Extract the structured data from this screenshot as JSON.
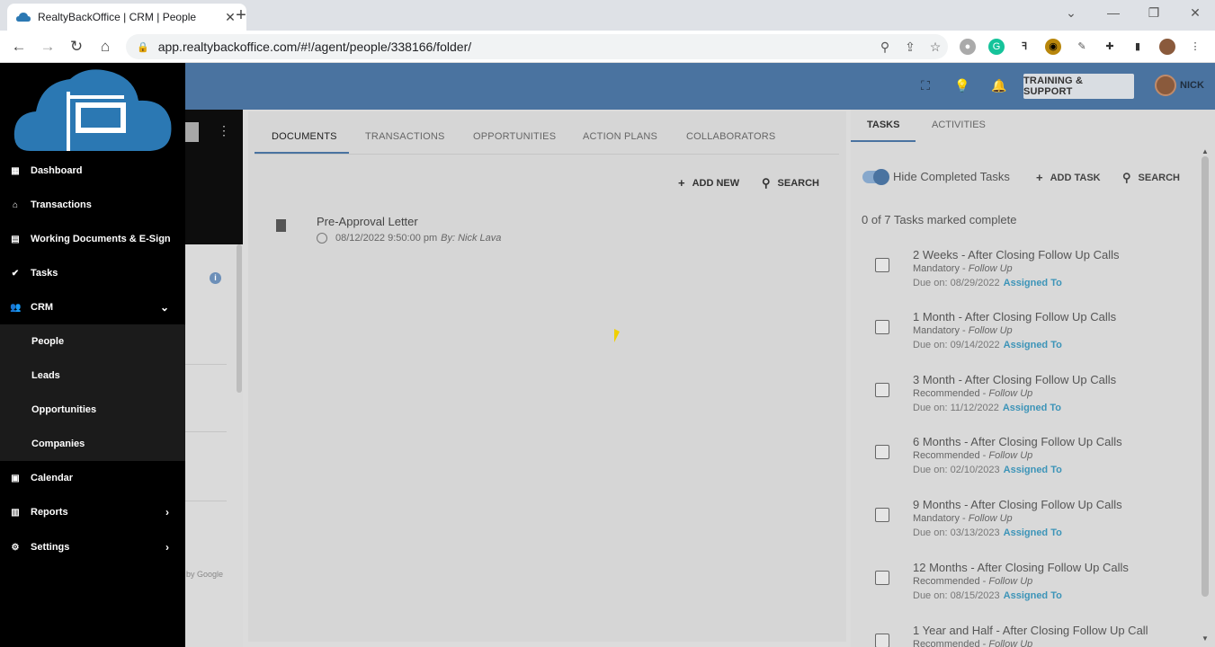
{
  "browser": {
    "tab_title": "RealtyBackOffice | CRM | People",
    "url": "app.realtybackoffice.com/#!/agent/people/338166/folder/"
  },
  "header": {
    "training_label": "TRAINING & SUPPORT",
    "user_name": "NICK"
  },
  "sidebar": {
    "items": [
      {
        "label": "Dashboard"
      },
      {
        "label": "Transactions"
      },
      {
        "label": "Working Documents & E-Sign"
      },
      {
        "label": "Tasks"
      },
      {
        "label": "CRM"
      },
      {
        "label": "Calendar"
      },
      {
        "label": "Reports"
      },
      {
        "label": "Settings"
      }
    ],
    "crm_subitems": [
      {
        "label": "People"
      },
      {
        "label": "Leads"
      },
      {
        "label": "Opportunities"
      },
      {
        "label": "Companies"
      }
    ]
  },
  "middle": {
    "google_credit": "by Google"
  },
  "documents": {
    "tabs": [
      {
        "label": "DOCUMENTS"
      },
      {
        "label": "TRANSACTIONS"
      },
      {
        "label": "OPPORTUNITIES"
      },
      {
        "label": "ACTION PLANS"
      },
      {
        "label": "COLLABORATORS"
      }
    ],
    "add_new_label": "ADD NEW",
    "search_label": "SEARCH",
    "items": [
      {
        "title": "Pre-Approval Letter",
        "date": "08/12/2022 9:50:00 pm",
        "by": "By: Nick Lava"
      }
    ]
  },
  "tasks": {
    "tabs": [
      {
        "label": "TASKS"
      },
      {
        "label": "ACTIVITIES"
      }
    ],
    "hide_completed_label": "Hide Completed Tasks",
    "hide_completed_on": true,
    "add_task_label": "ADD TASK",
    "search_label": "SEARCH",
    "complete_count": "0 of 7 Tasks marked complete",
    "items": [
      {
        "title": "2 Weeks - After Closing Follow Up Calls",
        "priority": "Mandatory",
        "category": "Follow Up",
        "due": "Due on: 08/29/2022",
        "assigned": "Assigned To"
      },
      {
        "title": "1 Month - After Closing Follow Up Calls",
        "priority": "Mandatory",
        "category": "Follow Up",
        "due": "Due on: 09/14/2022",
        "assigned": "Assigned To"
      },
      {
        "title": "3 Month - After Closing Follow Up Calls",
        "priority": "Recommended",
        "category": "Follow Up",
        "due": "Due on: 11/12/2022",
        "assigned": "Assigned To"
      },
      {
        "title": "6 Months - After Closing Follow Up Calls",
        "priority": "Recommended",
        "category": "Follow Up",
        "due": "Due on: 02/10/2023",
        "assigned": "Assigned To"
      },
      {
        "title": "9 Months - After Closing Follow Up Calls",
        "priority": "Mandatory",
        "category": "Follow Up",
        "due": "Due on: 03/13/2023",
        "assigned": "Assigned To"
      },
      {
        "title": "12 Months - After Closing Follow Up Calls",
        "priority": "Recommended",
        "category": "Follow Up",
        "due": "Due on: 08/15/2023",
        "assigned": "Assigned To"
      },
      {
        "title": "1 Year and Half - After Closing Follow Up Call",
        "priority": "Recommended",
        "category": "Follow Up",
        "due": "",
        "assigned": ""
      }
    ]
  },
  "colors": {
    "header_blue": "#4a73a0",
    "sidebar_black": "#000000",
    "logo_blue": "#2b78b3",
    "assigned_link": "#3c94b8"
  }
}
